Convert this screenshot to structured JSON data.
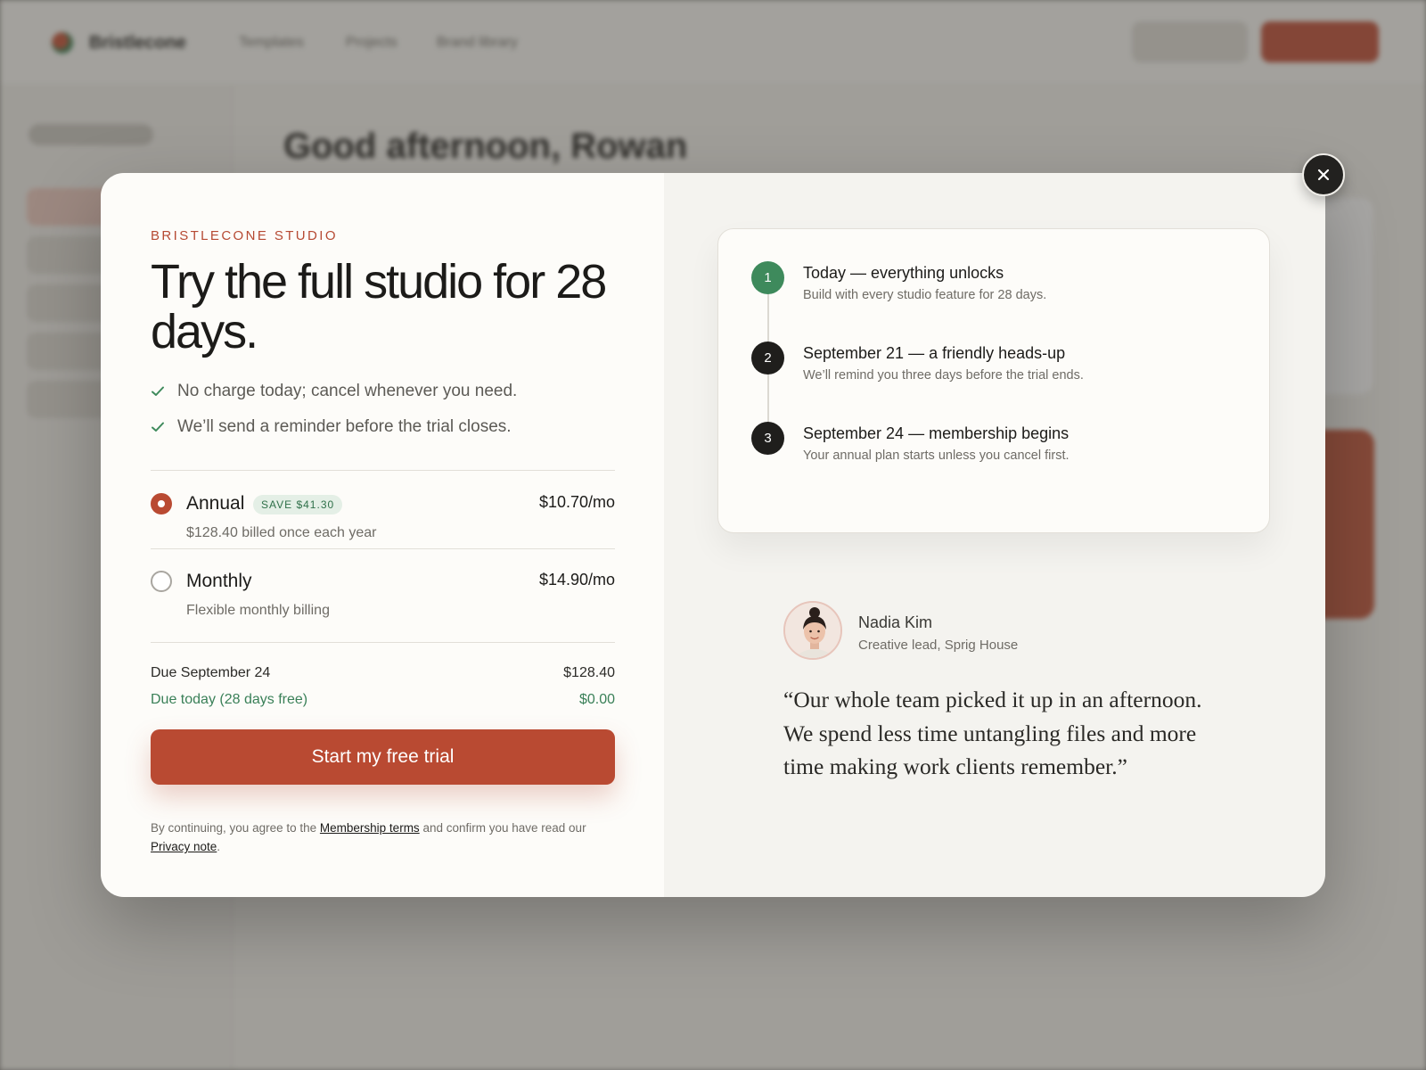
{
  "background": {
    "brand": "Bristlecone",
    "nav": [
      "Templates",
      "Projects",
      "Brand library"
    ],
    "greeting": "Good afternoon, Rowan"
  },
  "modal": {
    "eyebrow": "BRISTLECONE STUDIO",
    "headline": "Try the full studio for 28 days.",
    "benefits": [
      "No charge today; cancel whenever you need.",
      "We’ll send a reminder before the trial closes."
    ],
    "plans": [
      {
        "name": "Annual",
        "badge": "SAVE $41.30",
        "price": "$10.70/mo",
        "sub": "$128.40 billed once each year",
        "selected": true
      },
      {
        "name": "Monthly",
        "price": "$14.90/mo",
        "sub": "Flexible monthly billing",
        "selected": false
      }
    ],
    "summary": {
      "due_label": "Due September 24",
      "due_value": "$128.40",
      "today_label": "Due today (28 days free)",
      "today_value": "$0.00"
    },
    "cta_label": "Start my free trial",
    "legal": {
      "prefix": "By continuing, you agree to the",
      "terms_link": "Membership terms",
      "middle": "and confirm you have read our",
      "privacy_link": "Privacy note",
      "suffix": "."
    },
    "timeline": [
      {
        "step": "1",
        "title": "Today — everything unlocks",
        "desc": "Build with every studio feature for 28 days."
      },
      {
        "step": "2",
        "title": "September 21 — a friendly heads-up",
        "desc": "We’ll remind you three days before the trial ends."
      },
      {
        "step": "3",
        "title": "September 24 — membership begins",
        "desc": "Your annual plan starts unless you cancel first."
      }
    ],
    "testimonial": {
      "name": "Nadia Kim",
      "role": "Creative lead, Sprig House",
      "quote": "“Our whole team picked it up in an afternoon. We spend less time untangling files and more time making work clients remember.”"
    },
    "close_icon": "close-icon"
  },
  "colors": {
    "accent": "#b94a32",
    "success": "#3a8058",
    "dark": "#1c1b19"
  }
}
